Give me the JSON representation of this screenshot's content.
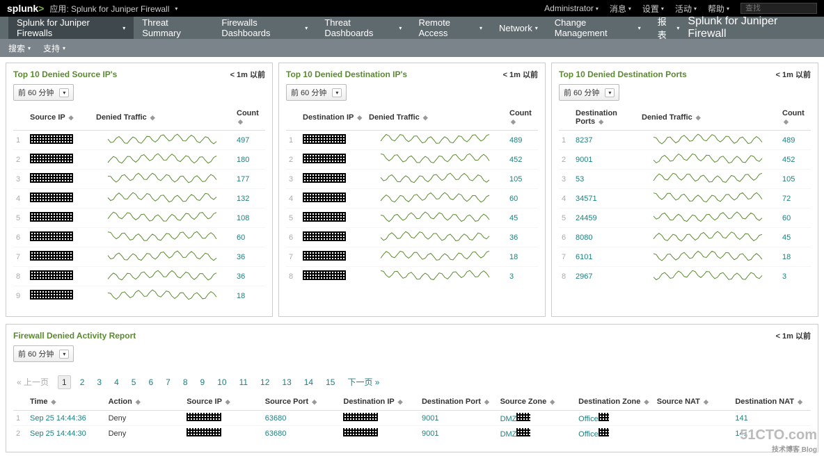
{
  "topbar": {
    "logo_text": "splunk>",
    "app_label": "应用: Splunk for Juniper Firewall",
    "right": [
      "Administrator",
      "消息",
      "设置",
      "活动",
      "帮助"
    ],
    "search_placeholder": "查找"
  },
  "nav": {
    "items": [
      {
        "label": "Splunk for Juniper Firewalls",
        "caret": true,
        "active": true
      },
      {
        "label": "Threat Summary",
        "caret": false
      },
      {
        "label": "Firewalls Dashboards",
        "caret": true
      },
      {
        "label": "Threat Dashboards",
        "caret": true
      },
      {
        "label": "Remote Access",
        "caret": true
      },
      {
        "label": "Network",
        "caret": true
      },
      {
        "label": "Change Management",
        "caret": true
      },
      {
        "label": "报表",
        "caret": true
      }
    ],
    "app_title": "Splunk for Juniper Firewall"
  },
  "subnav": {
    "items": [
      "搜索",
      "支持"
    ]
  },
  "timerange_label": "前 60 分钟",
  "refresh_label": "< 1m 以前",
  "panels": [
    {
      "title": "Top 10 Denied Source IP's",
      "cols": [
        "Source IP",
        "Denied Traffic",
        "Count"
      ],
      "rows": [
        {
          "i": 1,
          "k": "[redacted]02",
          "c": 497
        },
        {
          "i": 2,
          "k": "[redacted]",
          "c": 180
        },
        {
          "i": 3,
          "k": "[redacted]",
          "c": 177
        },
        {
          "i": 4,
          "k": "[redacted]",
          "c": 132
        },
        {
          "i": 5,
          "k": "[redacted]",
          "c": 108
        },
        {
          "i": 6,
          "k": "[redacted]9",
          "c": 60
        },
        {
          "i": 7,
          "k": "[redacted]",
          "c": 36
        },
        {
          "i": 8,
          "k": "[redacted]",
          "c": 36
        },
        {
          "i": 9,
          "k": "[redacted]",
          "c": 18
        }
      ]
    },
    {
      "title": "Top 10 Denied Destination IP's",
      "cols": [
        "Destination IP",
        "Denied Traffic",
        "Count"
      ],
      "rows": [
        {
          "i": 1,
          "k": "[redacted]",
          "c": 489
        },
        {
          "i": 2,
          "k": "[redacted]",
          "c": 452
        },
        {
          "i": 3,
          "k": "[redacted]",
          "c": 105
        },
        {
          "i": 4,
          "k": "[redacted]",
          "c": 60
        },
        {
          "i": 5,
          "k": "[redacted]",
          "c": 45
        },
        {
          "i": 6,
          "k": "[redacted]",
          "c": 36
        },
        {
          "i": 7,
          "k": "[redacted]",
          "c": 18
        },
        {
          "i": 8,
          "k": "[redacted]",
          "c": 3
        }
      ]
    },
    {
      "title": "Top 10 Denied Destination Ports",
      "cols": [
        "Destination Ports",
        "Denied Traffic",
        "Count"
      ],
      "rows": [
        {
          "i": 1,
          "k": "8237",
          "c": 489
        },
        {
          "i": 2,
          "k": "9001",
          "c": 452
        },
        {
          "i": 3,
          "k": "53",
          "c": 105
        },
        {
          "i": 4,
          "k": "34571",
          "c": 72
        },
        {
          "i": 5,
          "k": "24459",
          "c": 60
        },
        {
          "i": 6,
          "k": "8080",
          "c": 45
        },
        {
          "i": 7,
          "k": "6101",
          "c": 18
        },
        {
          "i": 8,
          "k": "2967",
          "c": 3
        }
      ]
    }
  ],
  "report": {
    "title": "Firewall Denied Activity Report",
    "pager": {
      "prev": "« 上一页",
      "pages": [
        1,
        2,
        3,
        4,
        5,
        6,
        7,
        8,
        9,
        10,
        11,
        12,
        13,
        14,
        15
      ],
      "next": "下一页 »",
      "current": 1
    },
    "cols": [
      "Time",
      "Action",
      "Source IP",
      "Source Port",
      "Destination IP",
      "Destination Port",
      "Source Zone",
      "Destination Zone",
      "Source NAT",
      "Destination NAT"
    ],
    "rows": [
      {
        "i": 1,
        "time": "Sep 25 14:44:36",
        "action": "Deny",
        "sip": "[redacted]",
        "sport": "63680",
        "dip": "[redacted]",
        "dport": "9001",
        "szone": "DMZ[redacted]",
        "dzone": "Office[redacted]",
        "snat": "",
        "dnat": "141"
      },
      {
        "i": 2,
        "time": "Sep 25 14:44:30",
        "action": "Deny",
        "sip": "[redacted]02",
        "sport": "63680",
        "dip": "[redacted]",
        "dport": "9001",
        "szone": "DMZ[redacted]",
        "dzone": "Office[redacted]",
        "snat": "",
        "dnat": "141"
      }
    ]
  },
  "watermark": {
    "main": "51CTO.com",
    "sub": "技术博客  Blog"
  }
}
